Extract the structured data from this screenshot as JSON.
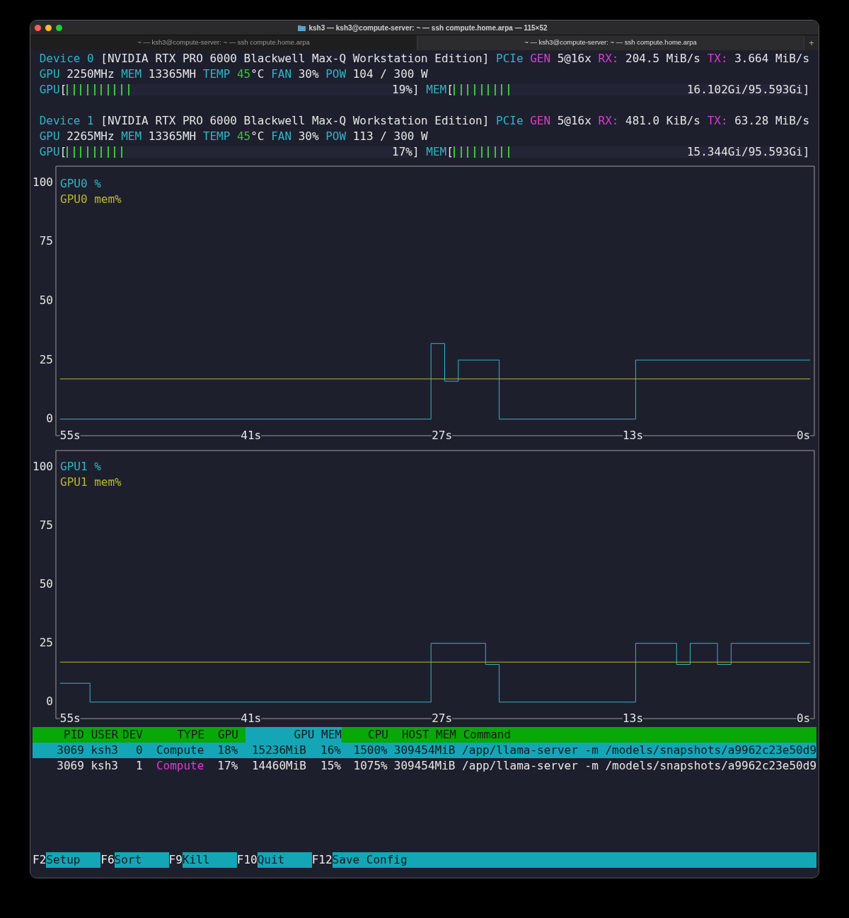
{
  "window": {
    "title": "ksh3 — ksh3@compute-server: ~ — ssh compute.home.arpa — 115×52"
  },
  "tabs": [
    {
      "label": "~ — ksh3@compute-server: ~ — ssh compute.home.arpa",
      "selected": false
    },
    {
      "label": "~ — ksh3@compute-server: ~ — ssh compute.home.arpa",
      "selected": true
    }
  ],
  "new_tab": "+",
  "gpus": [
    {
      "header": [
        {
          "text": "Device 0",
          "kind": "key"
        },
        {
          "text": "[NVIDIA RTX PRO 6000 Blackwell Max-Q Workstation Edition]",
          "kind": "text"
        },
        {
          "text": "PCIe",
          "kind": "key"
        },
        {
          "text": "GEN",
          "kind": "accent"
        },
        {
          "text": "5@16x",
          "kind": "text"
        },
        {
          "text": "RX:",
          "kind": "accent"
        },
        {
          "text": "204.5 MiB/s",
          "kind": "text"
        },
        {
          "text": "TX:",
          "kind": "accent"
        },
        {
          "text": "3.664 MiB/s",
          "kind": "text"
        }
      ],
      "stats": [
        {
          "text": "GPU",
          "kind": "key"
        },
        {
          "text": "2250MHz",
          "kind": "text"
        },
        {
          "text": "MEM",
          "kind": "key"
        },
        {
          "text": "13365MH",
          "kind": "text"
        },
        {
          "text": "TEMP",
          "kind": "key"
        },
        {
          "text": "45",
          "kind": "temp"
        },
        {
          "text": "°C",
          "kind": "unit"
        },
        {
          "text": "FAN",
          "kind": "key"
        },
        {
          "text": "30%",
          "kind": "text"
        },
        {
          "text": "POW",
          "kind": "key"
        },
        {
          "text": "104 / 300 W",
          "kind": "text"
        }
      ],
      "meters": [
        {
          "label": "GPU",
          "open": "[",
          "level": 0.19,
          "reading": "19%",
          "close": "]"
        },
        {
          "label": "MEM",
          "open": "[",
          "level": 0.168,
          "reading": "16.102Gi/95.593Gi",
          "close": "]"
        }
      ]
    },
    {
      "header": [
        {
          "text": "Device 1",
          "kind": "key"
        },
        {
          "text": "[NVIDIA RTX PRO 6000 Blackwell Max-Q Workstation Edition]",
          "kind": "text"
        },
        {
          "text": "PCIe",
          "kind": "key"
        },
        {
          "text": "GEN",
          "kind": "accent"
        },
        {
          "text": "5@16x",
          "kind": "text"
        },
        {
          "text": "RX:",
          "kind": "accent"
        },
        {
          "text": "481.0 KiB/s",
          "kind": "text"
        },
        {
          "text": "TX:",
          "kind": "accent"
        },
        {
          "text": "63.28 MiB/s",
          "kind": "text"
        }
      ],
      "stats": [
        {
          "text": "GPU",
          "kind": "key"
        },
        {
          "text": "2265MHz",
          "kind": "text"
        },
        {
          "text": "MEM",
          "kind": "key"
        },
        {
          "text": "13365MH",
          "kind": "text"
        },
        {
          "text": "TEMP",
          "kind": "key"
        },
        {
          "text": "45",
          "kind": "temp"
        },
        {
          "text": "°C",
          "kind": "unit"
        },
        {
          "text": "FAN",
          "kind": "key"
        },
        {
          "text": "30%",
          "kind": "text"
        },
        {
          "text": "POW",
          "kind": "key"
        },
        {
          "text": "113 / 300 W",
          "kind": "text"
        }
      ],
      "meters": [
        {
          "label": "GPU",
          "open": "[",
          "level": 0.17,
          "reading": "17%",
          "close": "]"
        },
        {
          "label": "MEM",
          "open": "[",
          "level": 0.16,
          "reading": "15.344Gi/95.593Gi",
          "close": "]"
        }
      ]
    }
  ],
  "charts": [
    {
      "chart_data": {
        "type": "line",
        "x": [
          55,
          27.8,
          27.8,
          26.8,
          26.8,
          25.8,
          25.8,
          22.8,
          22.8,
          12.8,
          12.8,
          0
        ],
        "xlim": [
          55.3,
          -0.3
        ],
        "ylim": [
          -7,
          107
        ],
        "xticks": [
          {
            "value": 55,
            "label": "55s"
          },
          {
            "value": 41,
            "label": "41s"
          },
          {
            "value": 27,
            "label": "27s"
          },
          {
            "value": 13,
            "label": "13s"
          },
          {
            "value": 0,
            "label": "0s"
          }
        ],
        "yticks": [
          0,
          25,
          50,
          75,
          100
        ],
        "series": [
          {
            "name": "GPU0 %",
            "color": "#2fb5c6",
            "values": [
              0,
              0,
              32,
              32,
              16,
              16,
              25,
              25,
              0,
              0,
              25,
              25
            ]
          },
          {
            "name": "GPU0 mem%",
            "color": "#b8b82c",
            "values": [
              17,
              17,
              17,
              17,
              17,
              17,
              17,
              17,
              17,
              17,
              17,
              17
            ]
          }
        ]
      }
    },
    {
      "chart_data": {
        "type": "line",
        "x": [
          55,
          52.8,
          52.8,
          27.8,
          27.8,
          23.8,
          23.8,
          22.8,
          22.8,
          12.8,
          12.8,
          9.8,
          9.8,
          8.8,
          8.8,
          6.8,
          6.8,
          5.8,
          5.8,
          0
        ],
        "xlim": [
          55.3,
          -0.3
        ],
        "ylim": [
          -7,
          107
        ],
        "xticks": [
          {
            "value": 55,
            "label": "55s"
          },
          {
            "value": 41,
            "label": "41s"
          },
          {
            "value": 27,
            "label": "27s"
          },
          {
            "value": 13,
            "label": "13s"
          },
          {
            "value": 0,
            "label": "0s"
          }
        ],
        "yticks": [
          0,
          25,
          50,
          75,
          100
        ],
        "series": [
          {
            "name": "GPU1 %",
            "color": "#2fb5c6",
            "values": [
              8,
              8,
              0,
              0,
              25,
              25,
              16,
              16,
              0,
              0,
              25,
              25,
              16,
              16,
              25,
              25,
              16,
              16,
              25,
              25
            ]
          },
          {
            "name": "GPU1 mem%",
            "color": "#b8b82c",
            "values": [
              17,
              17,
              17,
              17,
              17,
              17,
              17,
              17,
              17,
              17,
              17,
              17,
              17,
              17,
              17,
              17,
              17,
              17,
              17,
              17
            ]
          }
        ]
      }
    }
  ],
  "processes": {
    "columns": [
      {
        "label": "PID",
        "selected": false
      },
      {
        "label": "USER",
        "selected": false
      },
      {
        "label": "DEV",
        "selected": false
      },
      {
        "label": "TYPE",
        "selected": false
      },
      {
        "label": "GPU",
        "selected": false
      },
      {
        "label": "GPU MEM",
        "selected": true
      },
      {
        "label": "CPU",
        "selected": false
      },
      {
        "label": "HOST MEM",
        "selected": false
      },
      {
        "label": "Command",
        "selected": false
      }
    ],
    "rows": [
      {
        "selected": true,
        "pid": "3069",
        "user": "ksh3",
        "dev": "0",
        "type": "Compute",
        "gpu": "18%",
        "gpu_mem": "15236MiB",
        "gpu_mem_pct": "16%",
        "cpu": "1500%",
        "host_mem": "309454MiB",
        "command": "/app/llama-server -m /models/snapshots/a9962c23e50d9"
      },
      {
        "selected": false,
        "pid": "3069",
        "user": "ksh3",
        "dev": "1",
        "type": "Compute",
        "gpu": "17%",
        "gpu_mem": "14460MiB",
        "gpu_mem_pct": "15%",
        "cpu": "1075%",
        "host_mem": "309454MiB",
        "command": "/app/llama-server -m /models/snapshots/a9962c23e50d9"
      }
    ]
  },
  "footer": [
    {
      "key": "F2",
      "label": "Setup"
    },
    {
      "key": "F6",
      "label": "Sort"
    },
    {
      "key": "F9",
      "label": "Kill"
    },
    {
      "key": "F10",
      "label": "Quit"
    },
    {
      "key": "F12",
      "label": "Save Config"
    }
  ]
}
